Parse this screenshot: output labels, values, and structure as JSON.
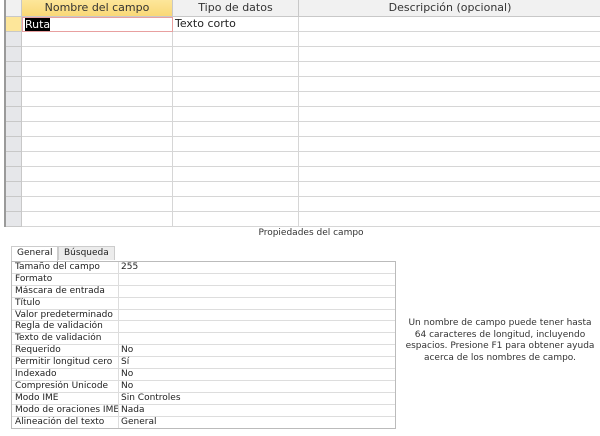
{
  "grid": {
    "headers": [
      "Nombre del campo",
      "Tipo de datos",
      "Descripción (opcional)"
    ],
    "rows": [
      {
        "name": "Ruta",
        "type": "Texto corto",
        "description": ""
      }
    ],
    "empty_rows": 13
  },
  "properties": {
    "caption": "Propiedades del campo",
    "tabs": [
      "General",
      "Búsqueda"
    ],
    "active_tab": "General",
    "items": [
      {
        "label": "Tamaño del campo",
        "value": "255"
      },
      {
        "label": "Formato",
        "value": ""
      },
      {
        "label": "Máscara de entrada",
        "value": ""
      },
      {
        "label": "Título",
        "value": ""
      },
      {
        "label": "Valor predeterminado",
        "value": ""
      },
      {
        "label": "Regla de validación",
        "value": ""
      },
      {
        "label": "Texto de validación",
        "value": ""
      },
      {
        "label": "Requerido",
        "value": "No"
      },
      {
        "label": "Permitir longitud cero",
        "value": "Sí"
      },
      {
        "label": "Indexado",
        "value": "No"
      },
      {
        "label": "Compresión Unicode",
        "value": "No"
      },
      {
        "label": "Modo IME",
        "value": "Sin Controles"
      },
      {
        "label": "Modo de oraciones IME",
        "value": "Nada"
      },
      {
        "label": "Alineación del texto",
        "value": "General"
      }
    ]
  },
  "help_text": "Un nombre de campo puede tener hasta 64 caracteres de longitud, incluyendo espacios. Presione F1 para obtener ayuda acerca de los nombres de campo.",
  "colors": {
    "active_header": "#f9d877",
    "selection": "#000000"
  }
}
